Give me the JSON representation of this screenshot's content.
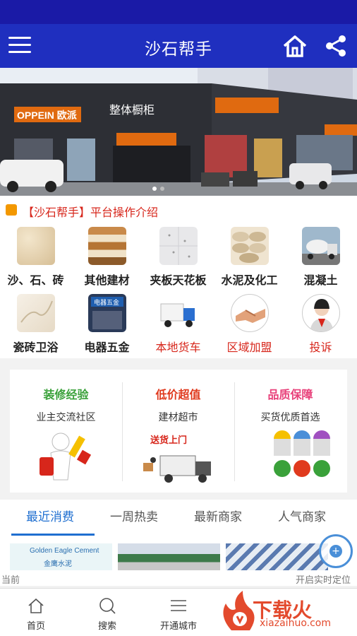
{
  "header": {
    "title": "沙石帮手",
    "menu_icon": "menu-icon",
    "home_icon": "home-icon",
    "share_icon": "share-icon"
  },
  "banner": {
    "sign_brand": "OPPEIN 欧派",
    "sign_text": "整体橱柜"
  },
  "notice": {
    "text": "【沙石帮手】平台操作介绍"
  },
  "categories": [
    {
      "label": "沙、石、砖",
      "icon": "sand-icon"
    },
    {
      "label": "其他建材",
      "icon": "warehouse-icon"
    },
    {
      "label": "夹板天花板",
      "icon": "ceiling-icon"
    },
    {
      "label": "水泥及化工",
      "icon": "cement-bags-icon"
    },
    {
      "label": "混凝土",
      "icon": "mixer-truck-icon"
    },
    {
      "label": "瓷砖卫浴",
      "icon": "tile-icon"
    },
    {
      "label": "电器五金",
      "icon": "hardware-store-icon"
    },
    {
      "label": "本地货车",
      "icon": "truck-icon"
    },
    {
      "label": "区域加盟",
      "icon": "handshake-icon"
    },
    {
      "label": "投诉",
      "icon": "agent-icon"
    }
  ],
  "features": [
    {
      "title": "装修经验",
      "subtitle": "业主交流社区",
      "color": "#3aa13a"
    },
    {
      "title": "低价超值",
      "subtitle": "建材超市",
      "color": "#e03a1e",
      "art_text": "送货上门"
    },
    {
      "title": "品质保障",
      "subtitle": "买货优质首选",
      "color": "#e8407a"
    }
  ],
  "tabs": [
    {
      "label": "最近消费",
      "active": true
    },
    {
      "label": "一周热卖",
      "active": false
    },
    {
      "label": "最新商家",
      "active": false
    },
    {
      "label": "人气商家",
      "active": false
    }
  ],
  "thumbs": {
    "first_caption": "Golden Eagle Cement",
    "first_caption_cn": "金鹰水泥"
  },
  "location": {
    "left_label": "当前",
    "right_label": "开启实时定位"
  },
  "bottom_nav": [
    {
      "label": "首页",
      "icon": "home-icon"
    },
    {
      "label": "搜索",
      "icon": "search-icon"
    },
    {
      "label": "开通城市",
      "icon": "list-icon"
    }
  ],
  "watermark": {
    "text": "下载火",
    "url": "xiazaihuo.com"
  },
  "colors": {
    "navbar": "#1f2fbf",
    "statusbar": "#1a1aa6",
    "accent_red": "#d7261b",
    "tab_active": "#1f6fd0"
  }
}
